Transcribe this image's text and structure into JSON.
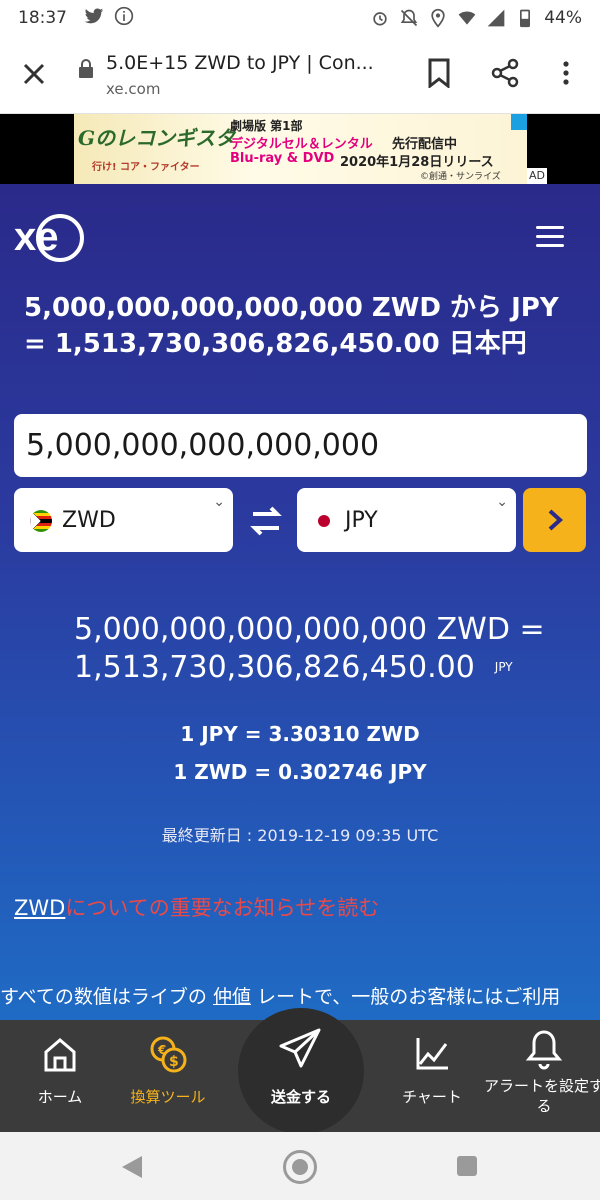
{
  "status_bar": {
    "time": "18:37",
    "battery": "44%",
    "left_icons": [
      "twitter-icon",
      "info-icon"
    ],
    "right_icons": [
      "alarm-icon",
      "mute-icon",
      "location-icon",
      "wifi-icon",
      "signal-icon",
      "battery-icon"
    ]
  },
  "browser": {
    "page_title": "5.0E+15 ZWD to JPY | Con...",
    "url": "xe.com"
  },
  "ad": {
    "brand": "Gのレコンギスタ",
    "brand_sub": "行け! コア・ファイター",
    "line1": "劇場版 第1部",
    "line2": "デジタルセル＆レンタル",
    "line2b": "先行配信中",
    "line3": "Blu-ray & DVD",
    "line3b": "2020年1月28日リリース",
    "line4": "©創通・サンライズ",
    "ad_label": "AD"
  },
  "xe": {
    "logo_text": "xe",
    "heading": "5,000,000,000,000,000 ZWD から JPY = 1,513,730,306,826,450.00 日本円",
    "amount_value": "5,000,000,000,000,000",
    "from_currency": "ZWD",
    "to_currency": "JPY",
    "result_line1": "5,000,000,000,000,000 ZWD =",
    "result_value": "1,513,730,306,826,450.00",
    "result_unit": "JPY",
    "rate1": "1 JPY = 3.30310 ZWD",
    "rate2": "1 ZWD = 0.302746 JPY",
    "last_updated": "最終更新日 : 2019-12-19 09:35 UTC",
    "notice_code": "ZWD",
    "notice_text": "についての重要なお知らせを読む",
    "disclaimer_pre": "すべての数値はライブの",
    "disclaimer_link": "仲値",
    "disclaimer_post": " レートで、一般のお客様にはご利用"
  },
  "bottom_nav": {
    "items": [
      {
        "label": "ホーム",
        "icon": "home-icon"
      },
      {
        "label": "換算ツール",
        "icon": "currency-coins-icon"
      },
      {
        "label": "送金する",
        "icon": "paper-plane-icon"
      },
      {
        "label": "チャート",
        "icon": "chart-icon"
      },
      {
        "label": "アラートを設定する",
        "icon": "bell-icon"
      }
    ],
    "active_color": "#f5b21b"
  },
  "colors": {
    "accent": "#f5b21b",
    "notice_red": "#e84a4a",
    "xe_blue": "#2a2a8a"
  }
}
